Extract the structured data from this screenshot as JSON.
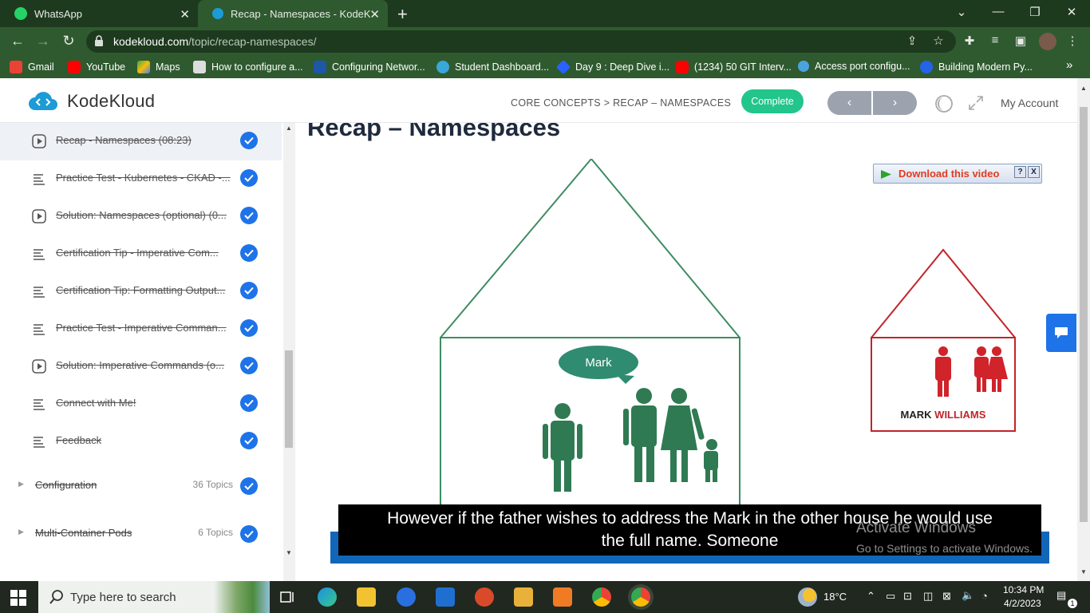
{
  "browser": {
    "tabs": [
      {
        "title": "WhatsApp",
        "active": false
      },
      {
        "title": "Recap - Namespaces - KodeKlou",
        "active": true
      }
    ],
    "url_domain": "kodekloud.com",
    "url_path": "/topic/recap-namespaces/",
    "bookmarks": [
      {
        "label": "Gmail",
        "icon": "gmail-icon"
      },
      {
        "label": "YouTube",
        "icon": "youtube-icon"
      },
      {
        "label": "Maps",
        "icon": "maps-icon"
      },
      {
        "label": "How to configure a...",
        "icon": "page-icon"
      },
      {
        "label": "Configuring Networ...",
        "icon": "vmware-icon"
      },
      {
        "label": "Student Dashboard...",
        "icon": "cloud-icon"
      },
      {
        "label": "Day 9 : Deep Dive i...",
        "icon": "diamond-icon"
      },
      {
        "label": "(1234) 50 GIT Interv...",
        "icon": "youtube-icon"
      },
      {
        "label": "Access port configu...",
        "icon": "link-icon"
      },
      {
        "label": "Building Modern Py...",
        "icon": "c-icon"
      }
    ]
  },
  "header": {
    "logo": "KodeKloud",
    "breadcrumb": "CORE CONCEPTS > RECAP – NAMESPACES",
    "complete_label": "Complete",
    "prev_label": "‹",
    "next_label": "›",
    "account_label": "My Account"
  },
  "sidebar": {
    "lessons": [
      {
        "title": "Recap - Namespaces (08:23)",
        "type": "video",
        "done": true,
        "active": true
      },
      {
        "title": "Practice Test - Kubernetes - CKAD -...",
        "type": "text",
        "done": true,
        "active": false
      },
      {
        "title": "Solution: Namespaces (optional) (0...",
        "type": "video",
        "done": true,
        "active": false
      },
      {
        "title": "Certification Tip - Imperative Com...",
        "type": "text",
        "done": true,
        "active": false
      },
      {
        "title": "Certification Tip: Formatting Output...",
        "type": "text",
        "done": true,
        "active": false
      },
      {
        "title": "Practice Test - Imperative Comman...",
        "type": "text",
        "done": true,
        "active": false
      },
      {
        "title": "Solution: Imperative Commands (o...",
        "type": "video",
        "done": true,
        "active": false
      },
      {
        "title": "Connect with Me!",
        "type": "text",
        "done": true,
        "active": false
      },
      {
        "title": "Feedback",
        "type": "text",
        "done": true,
        "active": false
      }
    ],
    "topics": [
      {
        "title": "Configuration",
        "count": "36 Topics",
        "done": true
      },
      {
        "title": "Multi-Container Pods",
        "count": "6 Topics",
        "done": true
      }
    ]
  },
  "main": {
    "title": "Recap – Namespaces",
    "video": {
      "download_label": "Download this video",
      "help_label": "?",
      "close_label": "X",
      "bubble_label": "Mark",
      "house_label_1": "MARK",
      "house_label_2": "WILLIAMS",
      "caption_line_1": "However if the father wishes to address the Mark in the other house he would use",
      "caption_line_2": "the full name. Someone",
      "activate_line_1": "Activate Windows",
      "activate_line_2": "Go to Settings to activate Windows."
    }
  },
  "taskbar": {
    "search_placeholder": "Type here to search",
    "temperature": "18°C",
    "time": "10:34 PM",
    "date": "4/2/2023",
    "notification_count": "1"
  },
  "colors": {
    "house_green": "#3d8c63",
    "house_red": "#c0252b",
    "accent_blue": "#1e73e8",
    "complete_green": "#22c58b"
  }
}
